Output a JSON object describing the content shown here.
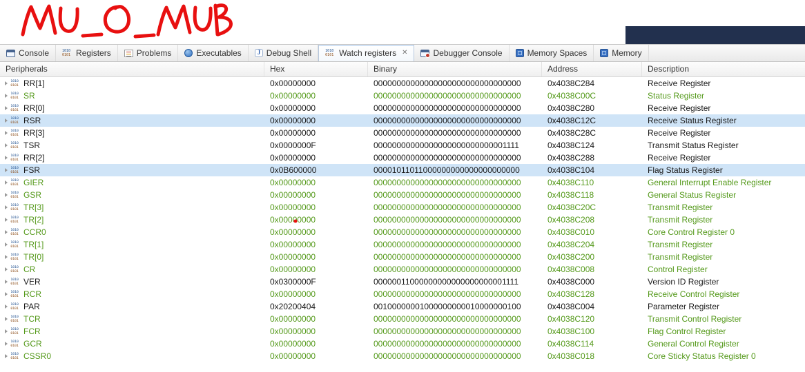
{
  "annotation": {
    "text": "MU_O_MUB",
    "color": "#e81010"
  },
  "window": {
    "titlebar_color": "#22304e"
  },
  "icons": {
    "close_glyph": "✕"
  },
  "tabs": [
    {
      "label": "Console",
      "icon": "console-icon",
      "active": false,
      "closable": false
    },
    {
      "label": "Registers",
      "icon": "registers-icon",
      "active": false,
      "closable": false
    },
    {
      "label": "Problems",
      "icon": "problems-icon",
      "active": false,
      "closable": false
    },
    {
      "label": "Executables",
      "icon": "executables-icon",
      "active": false,
      "closable": false
    },
    {
      "label": "Debug Shell",
      "icon": "debug-shell-icon",
      "active": false,
      "closable": false
    },
    {
      "label": "Watch registers",
      "icon": "watch-registers-icon",
      "active": true,
      "closable": true
    },
    {
      "label": "Debugger Console",
      "icon": "debugger-console-icon",
      "active": false,
      "closable": false
    },
    {
      "label": "Memory Spaces",
      "icon": "memory-spaces-icon",
      "active": false,
      "closable": false
    },
    {
      "label": "Memory",
      "icon": "memory-icon",
      "active": false,
      "closable": false
    }
  ],
  "table": {
    "columns": [
      "Peripherals",
      "Hex",
      "Binary",
      "Address",
      "Description"
    ],
    "colors": {
      "green": "#54991a",
      "black": "#1a1a1a",
      "selection_bg": "#cfe4f7"
    },
    "rows": [
      {
        "name": "RR[1]",
        "hex": "0x00000000",
        "binary": "00000000000000000000000000000000",
        "address": "0x4038C284",
        "description": "Receive Register",
        "color": "black",
        "selected": false
      },
      {
        "name": "SR",
        "hex": "0x00000000",
        "binary": "00000000000000000000000000000000",
        "address": "0x4038C00C",
        "description": "Status Register",
        "color": "green",
        "selected": false
      },
      {
        "name": "RR[0]",
        "hex": "0x00000000",
        "binary": "00000000000000000000000000000000",
        "address": "0x4038C280",
        "description": "Receive Register",
        "color": "black",
        "selected": false
      },
      {
        "name": "RSR",
        "hex": "0x00000000",
        "binary": "00000000000000000000000000000000",
        "address": "0x4038C12C",
        "description": "Receive Status Register",
        "color": "black",
        "selected": true
      },
      {
        "name": "RR[3]",
        "hex": "0x00000000",
        "binary": "00000000000000000000000000000000",
        "address": "0x4038C28C",
        "description": "Receive Register",
        "color": "black",
        "selected": false
      },
      {
        "name": "TSR",
        "hex": "0x0000000F",
        "binary": "00000000000000000000000000001111",
        "address": "0x4038C124",
        "description": "Transmit Status Register",
        "color": "black",
        "selected": false
      },
      {
        "name": "RR[2]",
        "hex": "0x00000000",
        "binary": "00000000000000000000000000000000",
        "address": "0x4038C288",
        "description": "Receive Register",
        "color": "black",
        "selected": false
      },
      {
        "name": "FSR",
        "hex": "0x0B600000",
        "binary": "00001011011000000000000000000000",
        "address": "0x4038C104",
        "description": "Flag Status Register",
        "color": "black",
        "selected": true
      },
      {
        "name": "GIER",
        "hex": "0x00000000",
        "binary": "00000000000000000000000000000000",
        "address": "0x4038C110",
        "description": "General Interrupt Enable Register",
        "color": "green",
        "selected": false
      },
      {
        "name": "GSR",
        "hex": "0x00000000",
        "binary": "00000000000000000000000000000000",
        "address": "0x4038C118",
        "description": "General Status Register",
        "color": "green",
        "selected": false
      },
      {
        "name": "TR[3]",
        "hex": "0x00000000",
        "binary": "00000000000000000000000000000000",
        "address": "0x4038C20C",
        "description": "Transmit Register",
        "color": "green",
        "selected": false
      },
      {
        "name": "TR[2]",
        "hex": "0x00000000",
        "binary": "00000000000000000000000000000000",
        "address": "0x4038C208",
        "description": "Transmit Register",
        "color": "green",
        "selected": false
      },
      {
        "name": "CCR0",
        "hex": "0x00000000",
        "binary": "00000000000000000000000000000000",
        "address": "0x4038C010",
        "description": "Core Control Register 0",
        "color": "green",
        "selected": false
      },
      {
        "name": "TR[1]",
        "hex": "0x00000000",
        "binary": "00000000000000000000000000000000",
        "address": "0x4038C204",
        "description": "Transmit Register",
        "color": "green",
        "selected": false
      },
      {
        "name": "TR[0]",
        "hex": "0x00000000",
        "binary": "00000000000000000000000000000000",
        "address": "0x4038C200",
        "description": "Transmit Register",
        "color": "green",
        "selected": false
      },
      {
        "name": "CR",
        "hex": "0x00000000",
        "binary": "00000000000000000000000000000000",
        "address": "0x4038C008",
        "description": "Control Register",
        "color": "green",
        "selected": false
      },
      {
        "name": "VER",
        "hex": "0x0300000F",
        "binary": "00000011000000000000000000001111",
        "address": "0x4038C000",
        "description": "Version ID Register",
        "color": "black",
        "selected": false
      },
      {
        "name": "RCR",
        "hex": "0x00000000",
        "binary": "00000000000000000000000000000000",
        "address": "0x4038C128",
        "description": "Receive Control Register",
        "color": "green",
        "selected": false
      },
      {
        "name": "PAR",
        "hex": "0x20200404",
        "binary": "00100000001000000000010000000100",
        "address": "0x4038C004",
        "description": "Parameter Register",
        "color": "black",
        "selected": false
      },
      {
        "name": "TCR",
        "hex": "0x00000000",
        "binary": "00000000000000000000000000000000",
        "address": "0x4038C120",
        "description": "Transmit Control Register",
        "color": "green",
        "selected": false
      },
      {
        "name": "FCR",
        "hex": "0x00000000",
        "binary": "00000000000000000000000000000000",
        "address": "0x4038C100",
        "description": "Flag Control Register",
        "color": "green",
        "selected": false
      },
      {
        "name": "GCR",
        "hex": "0x00000000",
        "binary": "00000000000000000000000000000000",
        "address": "0x4038C114",
        "description": "General Control Register",
        "color": "green",
        "selected": false
      },
      {
        "name": "CSSR0",
        "hex": "0x00000000",
        "binary": "00000000000000000000000000000000",
        "address": "0x4038C018",
        "description": "Core Sticky Status Register 0",
        "color": "green",
        "selected": false
      }
    ]
  }
}
